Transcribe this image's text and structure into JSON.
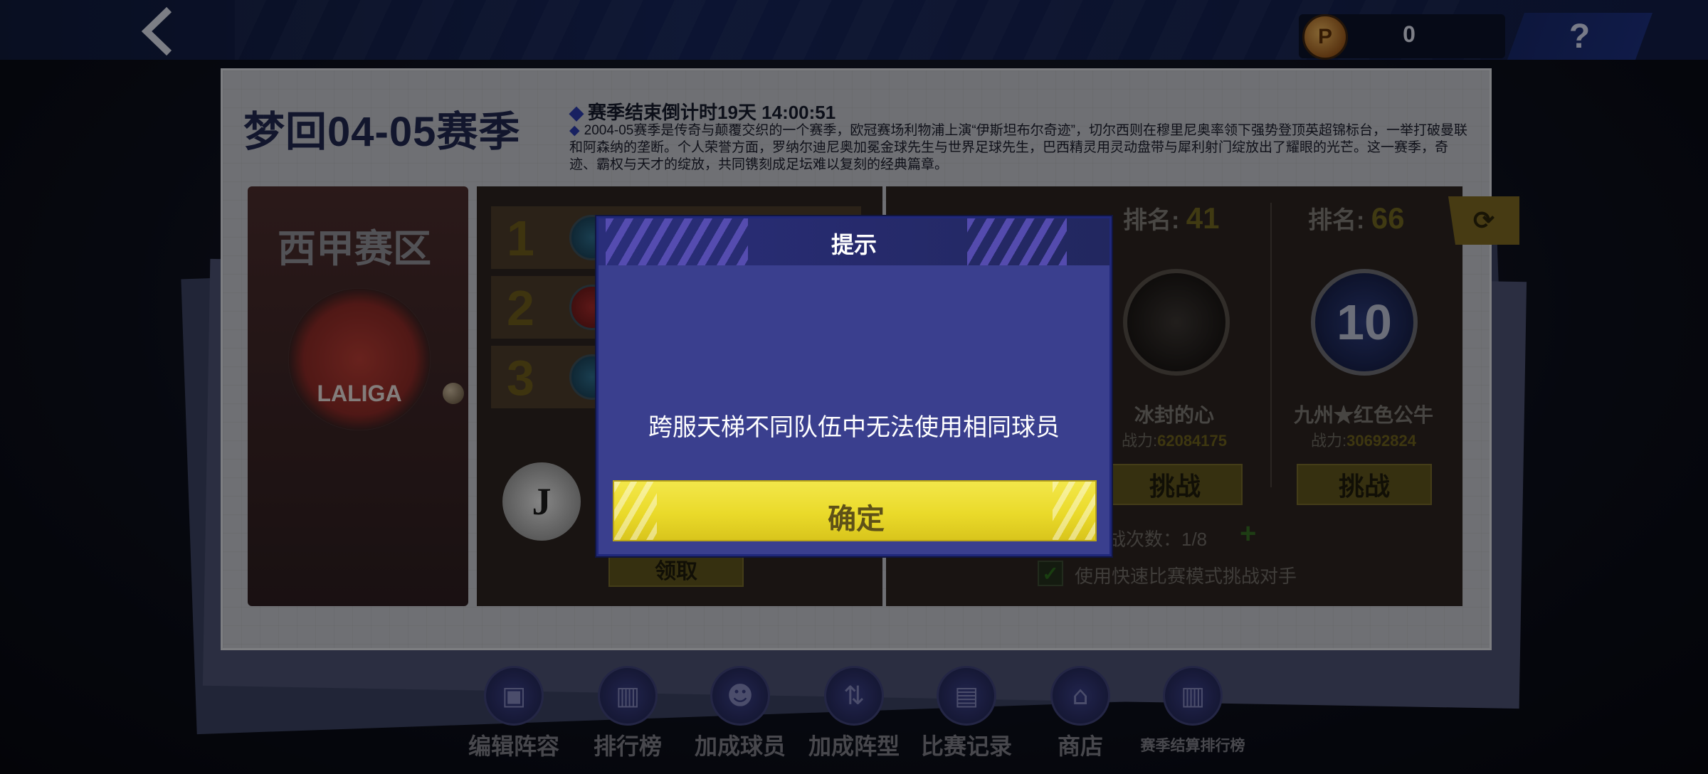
{
  "topbar": {
    "back_icon": "chevron-left-icon",
    "coin_glyph": "P",
    "coin_value": "0",
    "help_label": "?"
  },
  "season": {
    "title": "梦回04-05赛季",
    "countdown": "赛季结束倒计时19天 14:00:51",
    "description": "2004-05赛季是传奇与颠覆交织的一个赛季，欧冠赛场利物浦上演“伊斯坦布尔奇迹”，切尔西则在穆里尼奥率领下强势登顶英超锦标台，一举打破曼联和阿森纳的垄断。个人荣誉方面，罗纳尔迪尼奥加冕金球先生与世界足球先生，巴西精灵用灵动盘带与犀利射门绽放出了耀眼的光芒。这一赛季，奇迹、霸权与天才的绽放，共同镌刻成足坛难以复刻的经典篇章。"
  },
  "region": {
    "title": "西甲赛区",
    "logo_text": "LALIGA"
  },
  "leaderboard": {
    "ranks": [
      "1",
      "2",
      "3"
    ],
    "claim_label": "领取"
  },
  "opponents": [
    {
      "rank_label": "排名:",
      "rank": "41",
      "name": "冰封的心",
      "power_label": "战力:",
      "power": "62084175",
      "challenge_label": "挑战"
    },
    {
      "rank_label": "排名:",
      "rank": "66",
      "name": "九州★红色公牛",
      "power_label": "战力:",
      "power": "30692824",
      "challenge_label": "挑战",
      "emblem_text": "10"
    }
  ],
  "challenge_info": {
    "attempts": "战次数：1/8",
    "plus": "+",
    "quick_mode_label": "使用快速比赛模式挑战对手"
  },
  "bottom_nav": [
    {
      "label": "编辑阵容",
      "icon": "lineup-icon",
      "glyph": "▣"
    },
    {
      "label": "排行榜",
      "icon": "bar-chart-icon",
      "glyph": "▥"
    },
    {
      "label": "加成球员",
      "icon": "players-icon",
      "glyph": "☻"
    },
    {
      "label": "加成阵型",
      "icon": "formation-icon",
      "glyph": "⇅"
    },
    {
      "label": "比赛记录",
      "icon": "document-icon",
      "glyph": "▤"
    },
    {
      "label": "商店",
      "icon": "shop-icon",
      "glyph": "⌂"
    },
    {
      "label": "赛季结算排行榜",
      "icon": "season-ranking-icon",
      "glyph": "▥"
    }
  ],
  "modal": {
    "title": "提示",
    "message": "跨服天梯不同队伍中无法使用相同球员",
    "confirm_label": "确定"
  },
  "colors": {
    "modal_bg": "#3a3f8e",
    "confirm_yellow": "#eada2a",
    "confirm_text": "#5e5118"
  }
}
